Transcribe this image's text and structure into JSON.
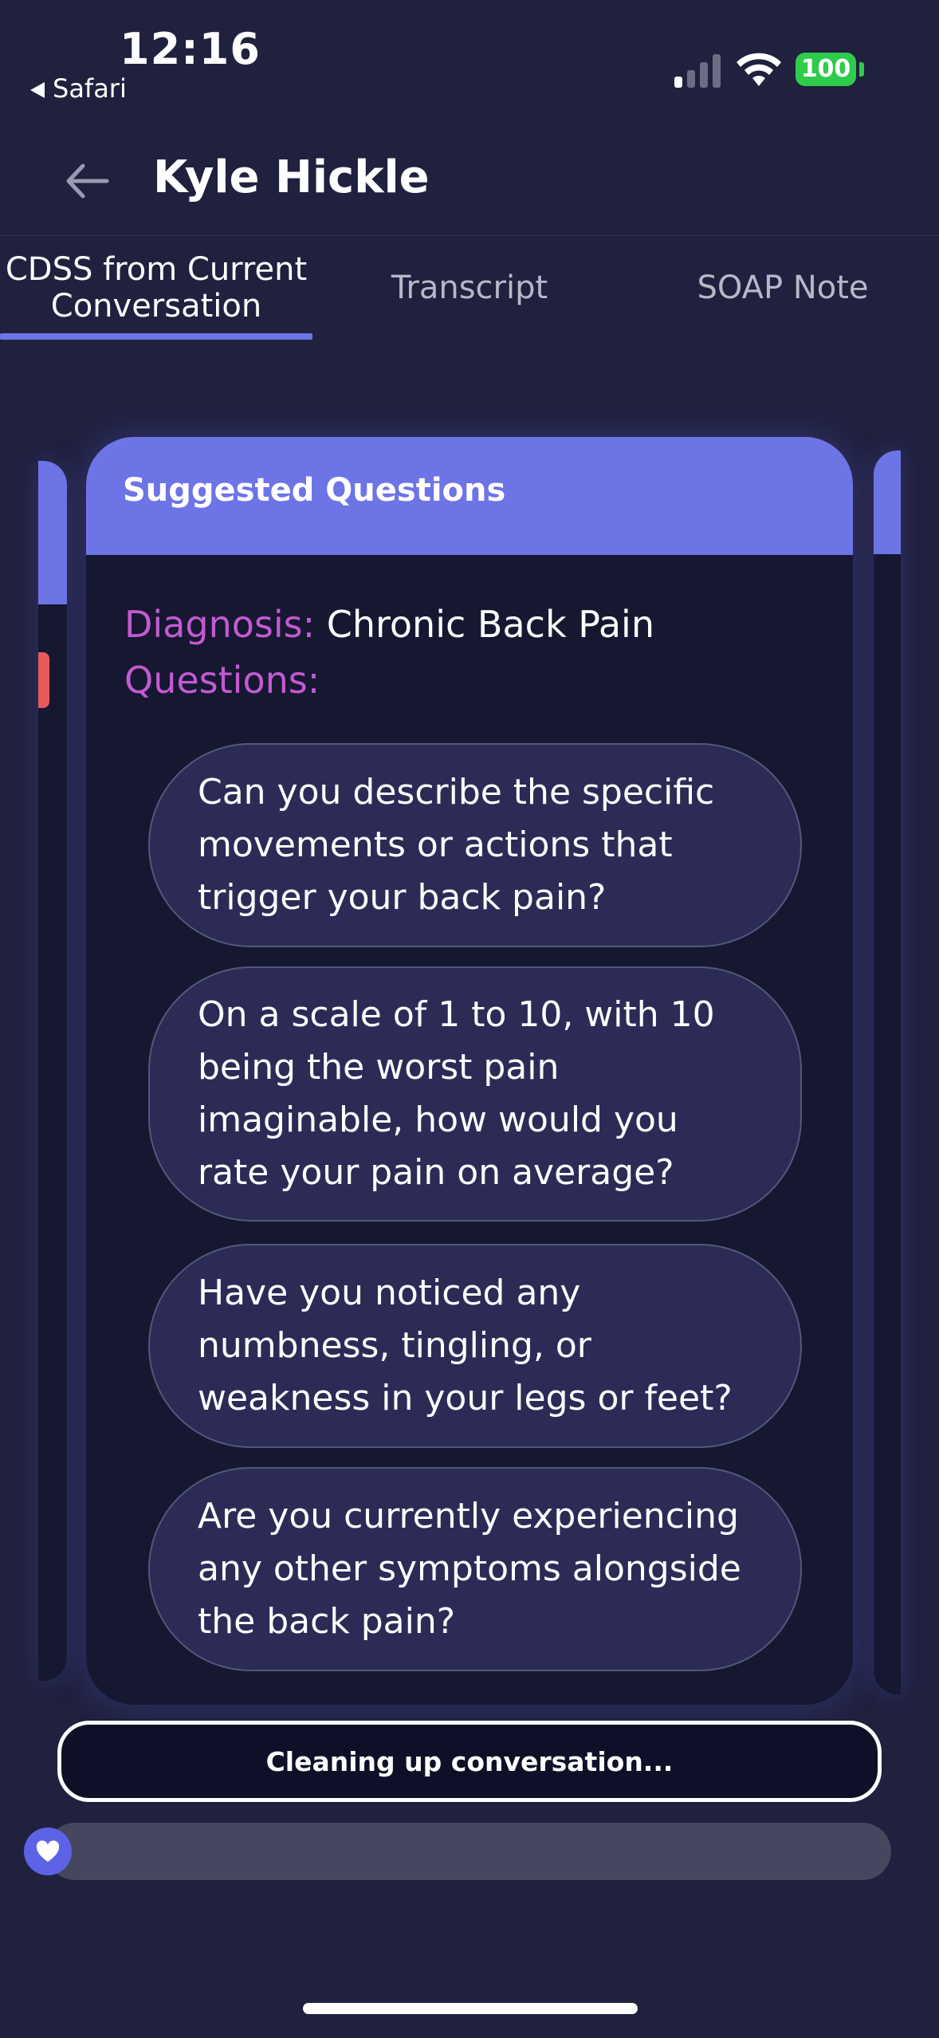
{
  "status_bar": {
    "time": "12:16",
    "back_app": "Safari",
    "battery": "100",
    "icons": [
      "signal-icon",
      "wifi-icon",
      "battery-icon"
    ]
  },
  "header": {
    "title": "Kyle Hickle",
    "back_icon": "back-arrow-icon"
  },
  "tabs": [
    {
      "label": "CDSS from Current Conversation",
      "active": true
    },
    {
      "label": "Transcript",
      "active": false
    },
    {
      "label": "SOAP Note",
      "active": false
    }
  ],
  "card": {
    "header": "Suggested Questions",
    "diagnosis_label": "Diagnosis:",
    "diagnosis_value": "Chronic Back Pain",
    "questions_label": "Questions:",
    "questions": [
      "Can you describe the specific movements or actions that trigger your back pain?",
      "On a scale of 1 to 10, with 10 being the worst pain imaginable, how would you rate your pain on average?",
      "Have you noticed any numbness, tingling, or weakness in your legs or feet?",
      "Are you currently experiencing any other symptoms alongside the back pain?"
    ]
  },
  "cleanup_button": "Cleaning up conversation...",
  "colors": {
    "background": "#20213f",
    "accent": "#6d75e6",
    "label_pink": "#c35ad2",
    "card": "#161731",
    "question_bubble": "#2b2b56"
  }
}
